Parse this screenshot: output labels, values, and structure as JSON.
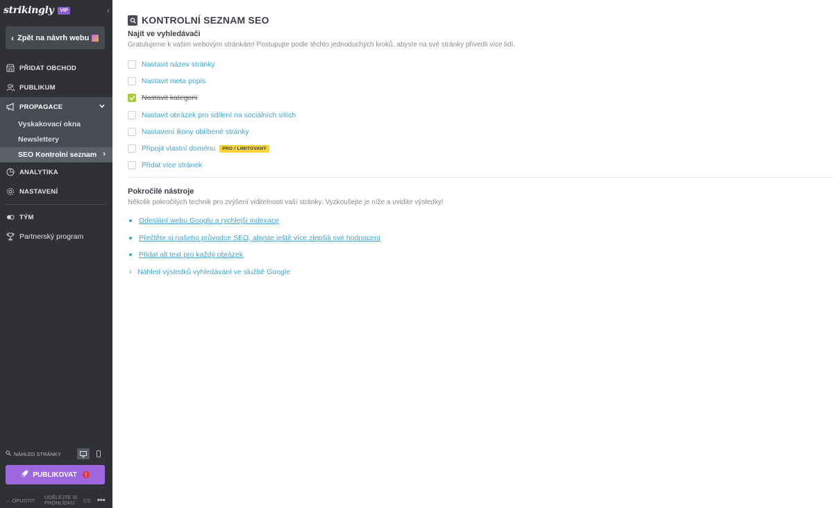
{
  "sidebar": {
    "logo": "strikingly",
    "vip": "VIP",
    "back_button": "Zpět na návrh webu",
    "nav": {
      "add_store": "PŘIDAT OBCHOD",
      "audience": "PUBLIKUM",
      "promotion": "PROPAGACE",
      "popups": "Vyskakovací okna",
      "newsletters": "Newslettery",
      "seo_checklist": "SEO Kontrolní seznam",
      "analytics": "ANALYTIKA",
      "settings": "NASTAVENÍ",
      "team": "TÝM",
      "partner": "Partnerský program"
    },
    "preview_label": "NÁHLED STRÁNKY",
    "publish": "PUBLIKOVAT",
    "footer": {
      "exit": "OPUSTIT",
      "review": "UDĚLEJTE SI PROHLÍDKU",
      "lang": "CS"
    }
  },
  "main": {
    "title": "KONTROLNÍ SEZNAM SEO",
    "find": {
      "title": "Najít ve vyhledávači",
      "desc": "Gratulujeme k vašim webovým stránkám! Postupujte podle těchto jednoduchých kroků, abyste na své stránky přivedli více lidí.",
      "items": [
        {
          "label": "Nastavit název stránky",
          "checked": false
        },
        {
          "label": "Nastavit meta popis",
          "checked": false
        },
        {
          "label": "Nastavit kategorii",
          "checked": true
        },
        {
          "label": "Nastavit obrázek pro sdílení na sociálních sítích",
          "checked": false
        },
        {
          "label": "Nastavení ikony oblíbené stránky",
          "checked": false
        },
        {
          "label": "Připojit vlastní doménu",
          "checked": false,
          "badge": "PRO / LIMITOVANÝ"
        },
        {
          "label": "Přidat více stránek",
          "checked": false
        }
      ]
    },
    "advanced": {
      "title": "Pokročilé nástroje",
      "desc": "Několik pokročilých technik pro zvýšení viditelnosti vaší stránky. Vyzkoušejte je níže a uvidíte výsledky!",
      "links": [
        "Odeslání webu Googlu a rychlejší indexace",
        "Přečtěte si našeho průvodce SEO, abyste ještě více zlepšili své hodnocení",
        "Přidat alt text pro každý obrázek"
      ],
      "expand": "Náhled výsledků vyhledávání ve službě Google"
    }
  },
  "colors": {
    "sidebar_bg": "#2f3136",
    "accent_link": "#3aa5d8",
    "publish": "#9e67e0",
    "checked": "#a5cc39",
    "badge": "#f6d53a"
  }
}
